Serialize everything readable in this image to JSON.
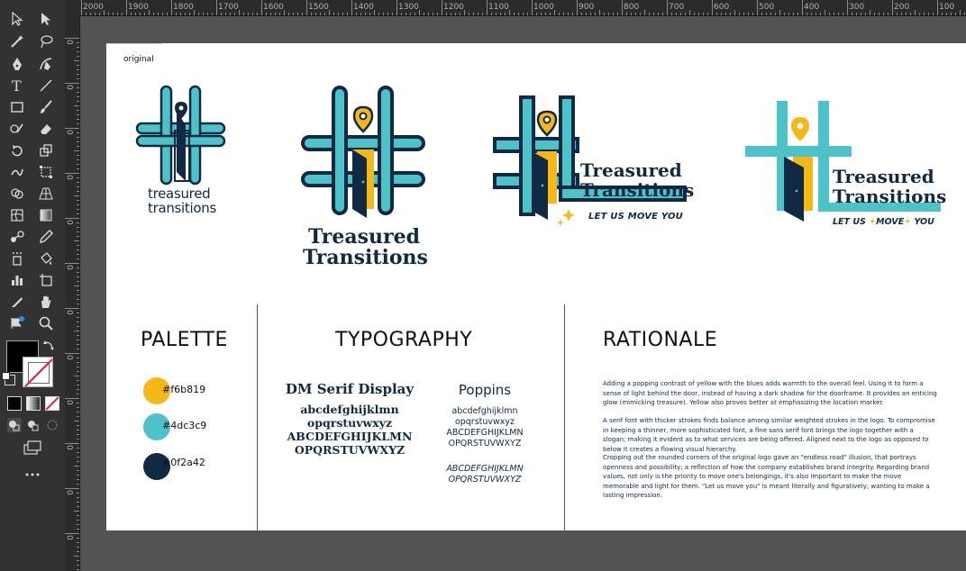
{
  "ruler": {
    "top_labels": [
      "2000",
      "1900",
      "1800",
      "1700",
      "1600",
      "1500",
      "1400",
      "1300",
      "1200",
      "1100",
      "1000",
      "900",
      "800",
      "700",
      "600",
      "500",
      "400",
      "300",
      "200",
      "100"
    ],
    "left_labels": [
      "0",
      "0",
      "0",
      "0",
      "0",
      "0",
      "0",
      "0",
      "0",
      "0",
      "0",
      "0"
    ]
  },
  "artboard": {
    "label_original": "original"
  },
  "logos": {
    "brand_line1": "Treasured",
    "brand_line2": "Transitions",
    "brand_lower_line1": "treasured",
    "brand_lower_line2": "transitions",
    "slogan": "LET US MOVE YOU",
    "slogan_parts": [
      "LET US",
      "MOVE",
      "YOU"
    ]
  },
  "palette": {
    "heading": "PALETTE",
    "colors": [
      {
        "hex": "#f6b819",
        "label": "#f6b819"
      },
      {
        "hex": "#4dc3c9",
        "label": "#4dc3c9"
      },
      {
        "hex": "#0f2a42",
        "label": "#0f2a42"
      }
    ]
  },
  "typography": {
    "heading": "TYPOGRAPHY",
    "font1": {
      "name": "DM Serif Display",
      "lines": [
        "abcdefghijklmn",
        "opqrstuvwxyz",
        "ABCDEFGHIJKLMN",
        "OPQRSTUVWXYZ"
      ]
    },
    "font2": {
      "name": "Poppins",
      "lines": [
        "abcdefghijklmn",
        "opqrstuvwxyz",
        "ABCDEFGHIJKLMN",
        "OPQRSTUVWXYZ"
      ],
      "italic_lines": [
        "ABCDEFGHIJKLMN",
        "OPQRSTUVWXYZ"
      ]
    }
  },
  "rationale": {
    "heading": "RATIONALE",
    "paragraphs": [
      "Adding a popping contrast of yellow with the blues adds warmth to the overall feel. Using it to form a sense of light behind the door, instead of having a dark shadow for the doorframe. It provides an enticing glow (mimicking treasure). Yellow also proves better at emphasizing the location marker.",
      "A serif font with thicker strokes finds balance among similar weighted strokes in the logo. To compromise in keeping a thinner, more sophisticated font, a fine sans serif font brings the logo together with a slogan; making it evident as to what services are being offered. Aligned next to the logo as opposed to below it creates a flowing visual hierarchy.",
      "Cropping out the rounded corners of the original logo gave an \"endless road\" illusion, that portrays openness and possibility; a reflection of how the company establishes brand integrity. Regarding brand values, not only is the priority to move one's belongings, it's also important to make the move memorable and light for them. \"Let us move you\" is meant literally and figuratively; wanting to make a lasting impression."
    ]
  },
  "colors": {
    "yellow": "#f6b819",
    "teal": "#4dc3c9",
    "navy": "#0f2a42",
    "canvas": "#535353",
    "panel": "#323232"
  }
}
